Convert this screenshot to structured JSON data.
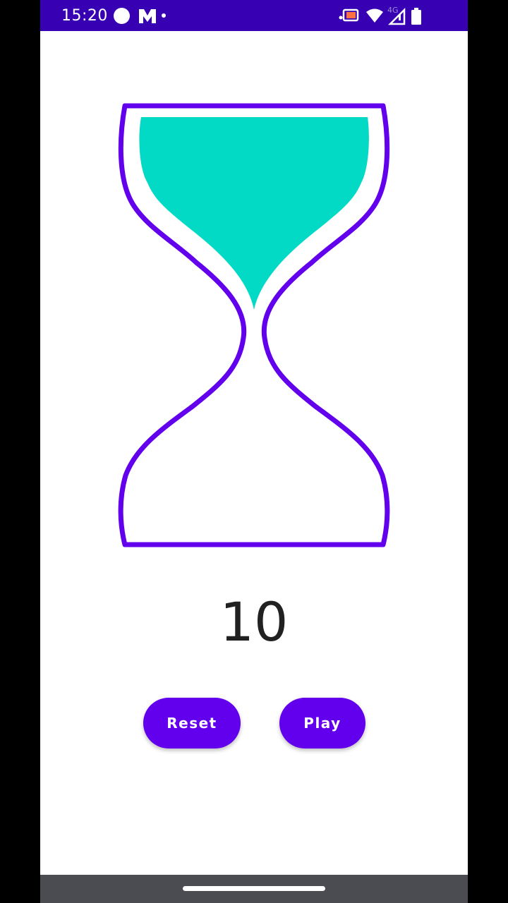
{
  "status_bar": {
    "time": "15:20",
    "network_label": "4G",
    "icons": [
      "circle-notification-icon",
      "m-app-icon",
      "cast-icon",
      "wifi-icon",
      "signal-icon",
      "battery-icon"
    ]
  },
  "hourglass": {
    "frame_color": "#6200ee",
    "sand_color": "#03dac5",
    "top_sand_fraction": 1.0,
    "bottom_sand_fraction": 0.0
  },
  "timer": {
    "value": "10"
  },
  "buttons": {
    "reset_label": "Reset",
    "play_label": "Play"
  },
  "colors": {
    "status_bar": "#3700b3",
    "accent": "#6200ee",
    "nav_bar": "#4a4c52"
  }
}
